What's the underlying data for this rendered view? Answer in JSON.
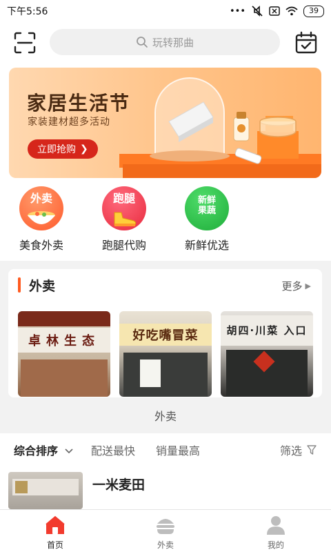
{
  "status_bar": {
    "time": "下午5:56",
    "battery": "39"
  },
  "search": {
    "placeholder": "玩转那曲"
  },
  "banner": {
    "title": "家居生活节",
    "subtitle": "家装建材超多活动",
    "cta": "立即抢购"
  },
  "quick_entries": [
    {
      "label": "美食外卖",
      "badge": "外卖",
      "color": "#ff6a3d"
    },
    {
      "label": "跑腿代购",
      "badge": "跑腿",
      "color": "#f4364c"
    },
    {
      "label": "新鲜优选",
      "badge": "新鲜果蔬",
      "color": "#2ec24a"
    }
  ],
  "takeout_card": {
    "title": "外卖",
    "more": "更多",
    "shops": [
      {
        "sign": "卓林生态"
      },
      {
        "sign": "好吃嘴冒菜"
      },
      {
        "sign": "胡四·川菜 入口"
      }
    ]
  },
  "section_footer": "外卖",
  "sort_bar": {
    "items": [
      "综合排序",
      "配送最快",
      "销量最高"
    ],
    "filter": "筛选"
  },
  "store": {
    "name": "一米麦田"
  },
  "bottom_nav": [
    {
      "label": "首页",
      "active": true
    },
    {
      "label": "外卖",
      "active": false
    },
    {
      "label": "我的",
      "active": false
    }
  ],
  "colors": {
    "accent": "#ff5a1f",
    "cta": "#d6261b",
    "nav_active": "#f23b2e"
  }
}
